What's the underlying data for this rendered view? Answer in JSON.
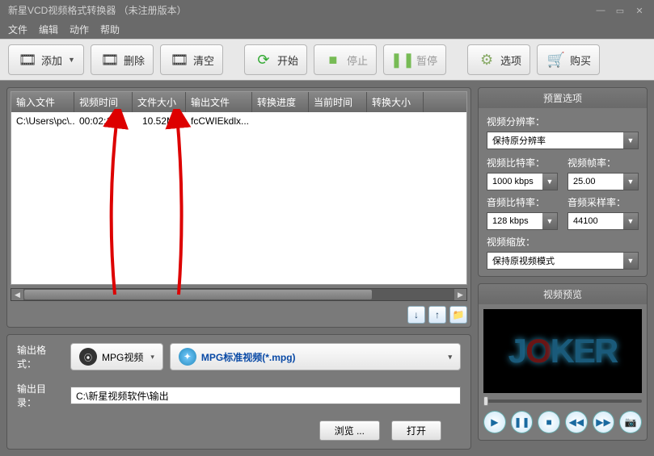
{
  "title": "新星VCD视频格式转换器  （未注册版本）",
  "menu": [
    "文件",
    "编辑",
    "动作",
    "帮助"
  ],
  "toolbar": {
    "add": "添加",
    "delete": "删除",
    "clear": "清空",
    "start": "开始",
    "stop": "停止",
    "pause": "暂停",
    "options": "选项",
    "buy": "购买"
  },
  "table": {
    "headers": [
      "输入文件",
      "视频时间",
      "文件大小",
      "输出文件",
      "转换进度",
      "当前时间",
      "转换大小"
    ],
    "rows": [
      {
        "input": "C:\\Users\\pc\\...",
        "time": "00:02:19",
        "size": "10.52MB",
        "output": "fcCWIEkdlx..."
      }
    ]
  },
  "output": {
    "format_label": "输出格式：",
    "category": "MPG视频",
    "preset": "MPG标准视频(*.mpg)",
    "dir_label": "输出目录：",
    "dir_value": "C:\\新星视频软件\\输出",
    "browse": "浏览 ...",
    "open": "打开"
  },
  "preset": {
    "title": "预置选项",
    "resolution_label": "视频分辨率：",
    "resolution": "保持原分辨率",
    "vbitrate_label": "视频比特率：",
    "vbitrate": "1000 kbps",
    "vfps_label": "视频帧率：",
    "vfps": "25.00",
    "abitrate_label": "音频比特率：",
    "abitrate": "128 kbps",
    "asample_label": "音频采样率：",
    "asample": "44100",
    "vzoom_label": "视频缩放：",
    "vzoom": "保持原视频模式"
  },
  "preview": {
    "title": "视频预览"
  }
}
